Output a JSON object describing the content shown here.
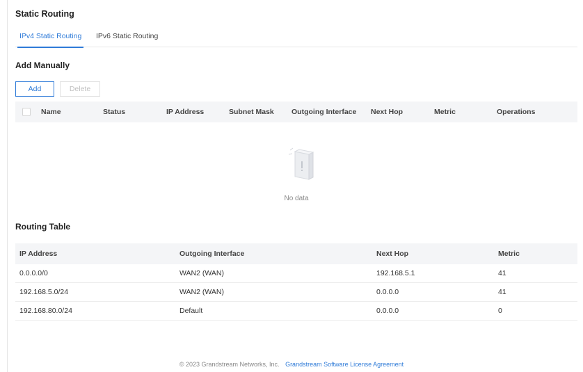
{
  "page": {
    "title": "Static Routing"
  },
  "tabs": [
    {
      "label": "IPv4 Static Routing",
      "active": true
    },
    {
      "label": "IPv6 Static Routing",
      "active": false
    }
  ],
  "add_manually": {
    "title": "Add Manually",
    "add_label": "Add",
    "delete_label": "Delete",
    "columns": [
      "Name",
      "Status",
      "IP Address",
      "Subnet Mask",
      "Outgoing Interface",
      "Next Hop",
      "Metric",
      "Operations"
    ],
    "empty_text": "No data"
  },
  "routing_table": {
    "title": "Routing Table",
    "columns": [
      "IP Address",
      "Outgoing Interface",
      "Next Hop",
      "Metric"
    ],
    "rows": [
      [
        "0.0.0.0/0",
        "WAN2 (WAN)",
        "192.168.5.1",
        "41"
      ],
      [
        "192.168.5.0/24",
        "WAN2 (WAN)",
        "0.0.0.0",
        "41"
      ],
      [
        "192.168.80.0/24",
        "Default",
        "0.0.0.0",
        "0"
      ]
    ]
  },
  "footer": {
    "copyright": "© 2023 Grandstream Networks, Inc.",
    "link": "Grandstream Software License Agreement"
  },
  "colors": {
    "accent": "#2f7bd8",
    "header_bg": "#f4f5f7",
    "border": "#ececec"
  }
}
